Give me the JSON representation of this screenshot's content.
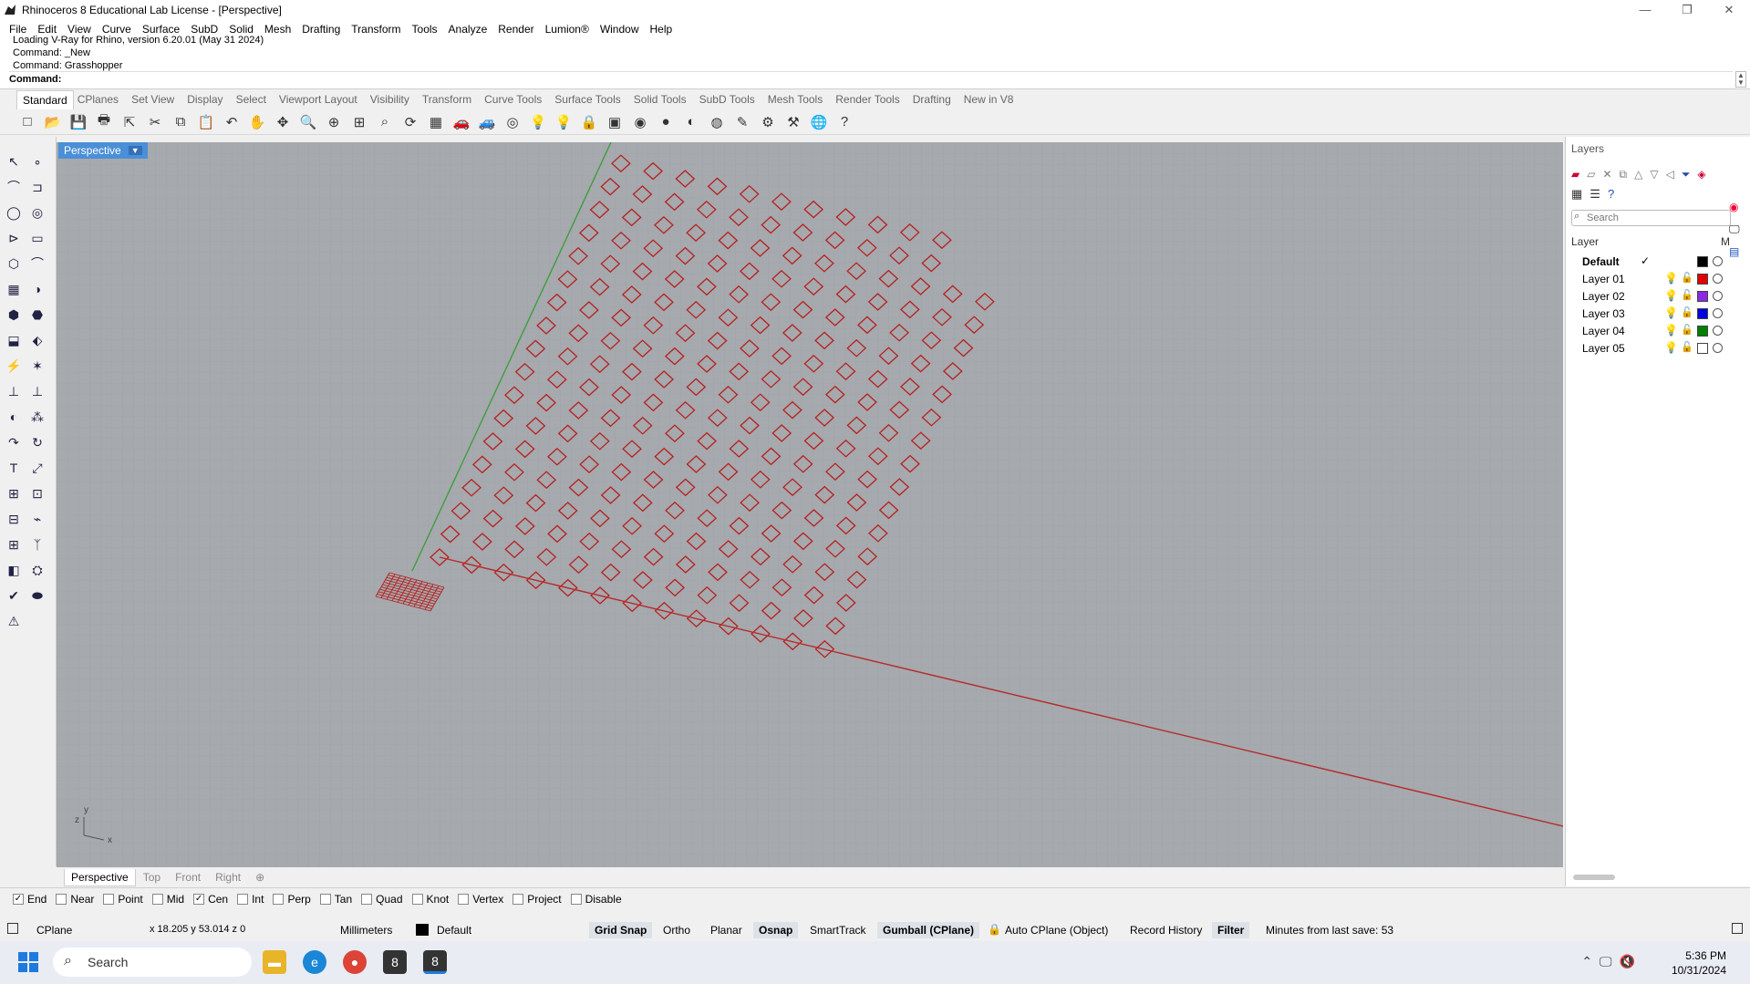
{
  "window": {
    "title": "Rhinoceros 8 Educational Lab License - [Perspective]"
  },
  "menu": [
    "File",
    "Edit",
    "View",
    "Curve",
    "Surface",
    "SubD",
    "Solid",
    "Mesh",
    "Drafting",
    "Transform",
    "Tools",
    "Analyze",
    "Render",
    "Lumion®",
    "Window",
    "Help"
  ],
  "command": {
    "history": [
      "Loading V-Ray for Rhino, version 6.20.01 (May 31 2024)",
      "Command: _New",
      "Command: Grasshopper"
    ],
    "prompt": "Command:"
  },
  "toolbar_tabs": [
    "Standard",
    "CPlanes",
    "Set View",
    "Display",
    "Select",
    "Viewport Layout",
    "Visibility",
    "Transform",
    "Curve Tools",
    "Surface Tools",
    "Solid Tools",
    "SubD Tools",
    "Mesh Tools",
    "Render Tools",
    "Drafting",
    "New in V8"
  ],
  "toolbar_icons": [
    "new-icon",
    "open-icon",
    "save-icon",
    "print-icon",
    "import-icon",
    "cut-icon",
    "copy-icon",
    "paste-icon",
    "undo-icon",
    "pan-icon",
    "rotate-view-icon",
    "zoom-icon",
    "zoom-window-icon",
    "zoom-extents-icon",
    "zoom-selected-icon",
    "rotate-icon",
    "grid-icon",
    "car-icon",
    "car-render-icon",
    "point-icon",
    "light-icon",
    "bulb-icon",
    "lock-icon",
    "material-icon",
    "color-wheel-icon",
    "sphere-icon",
    "shaded-sphere-icon",
    "render-sphere-icon",
    "brush-icon",
    "gear-icon",
    "options-icon",
    "globe-icon",
    "help-icon"
  ],
  "toolbar_glyphs": [
    "□",
    "📂",
    "💾",
    "🖶",
    "⇱",
    "✂",
    "⧉",
    "📋",
    "↶",
    "✋",
    "✥",
    "🔍",
    "⊕",
    "⊞",
    "⌕",
    "⟳",
    "▦",
    "🚗",
    "🚙",
    "◎",
    "💡",
    "💡",
    "🔒",
    "▣",
    "◉",
    "●",
    "◐",
    "◍",
    "✎",
    "⚙",
    "⚒",
    "🌐",
    "?"
  ],
  "viewport": {
    "name": "Perspective",
    "axis_labels": [
      "y",
      "z",
      "x"
    ]
  },
  "view_tabs": [
    "Perspective",
    "Top",
    "Front",
    "Right",
    "⊕"
  ],
  "osnap": [
    {
      "label": "End",
      "checked": true
    },
    {
      "label": "Near",
      "checked": false
    },
    {
      "label": "Point",
      "checked": false
    },
    {
      "label": "Mid",
      "checked": false
    },
    {
      "label": "Cen",
      "checked": true
    },
    {
      "label": "Int",
      "checked": false
    },
    {
      "label": "Perp",
      "checked": false
    },
    {
      "label": "Tan",
      "checked": false
    },
    {
      "label": "Quad",
      "checked": false
    },
    {
      "label": "Knot",
      "checked": false
    },
    {
      "label": "Vertex",
      "checked": false
    },
    {
      "label": "Project",
      "checked": false
    },
    {
      "label": "Disable",
      "checked": false
    }
  ],
  "status": {
    "cplane": "CPlane",
    "coords": "x 18.205  y 53.014  z 0",
    "units": "Millimeters",
    "layer": "Default",
    "grid_snap": "Grid Snap",
    "ortho": "Ortho",
    "planar": "Planar",
    "osnap": "Osnap",
    "smarttrack": "SmartTrack",
    "gumball": "Gumball (CPlane)",
    "autocplane": "Auto CPlane (Object)",
    "record_history": "Record History",
    "filter": "Filter",
    "last_save": "Minutes from last save: 53"
  },
  "layers": {
    "title": "Layers",
    "search_placeholder": "Search",
    "col_layer": "Layer",
    "col_m": "M",
    "rows": [
      {
        "name": "Default",
        "current": true,
        "color": "#000000"
      },
      {
        "name": "Layer 01",
        "current": false,
        "color": "#e00000"
      },
      {
        "name": "Layer 02",
        "current": false,
        "color": "#8a2be2"
      },
      {
        "name": "Layer 03",
        "current": false,
        "color": "#0000e0"
      },
      {
        "name": "Layer 04",
        "current": false,
        "color": "#008000"
      },
      {
        "name": "Layer 05",
        "current": false,
        "color": "#ffffff"
      }
    ]
  },
  "taskbar": {
    "search": "Search",
    "time": "5:36 PM",
    "date": "10/31/2024"
  }
}
